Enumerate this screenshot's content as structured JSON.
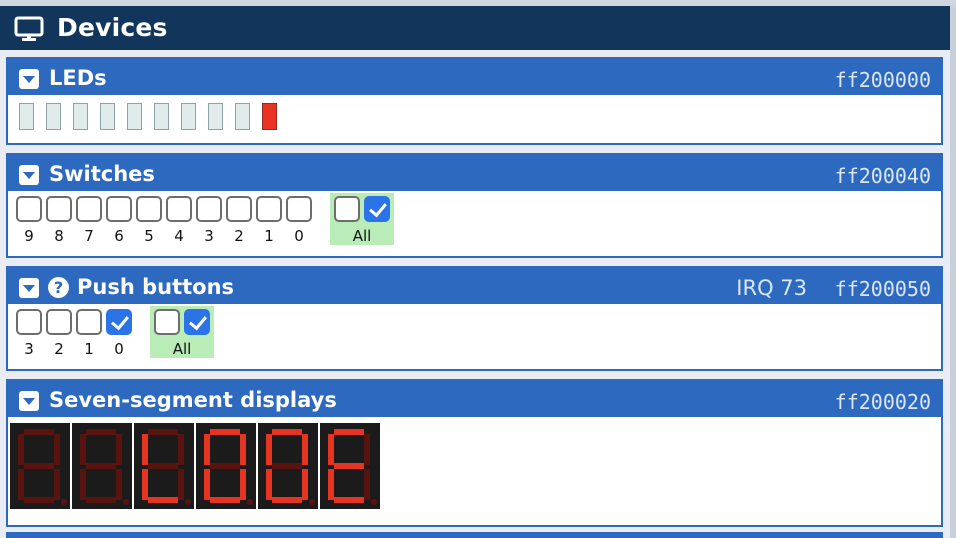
{
  "header": {
    "title": "Devices",
    "icon": "monitor-icon"
  },
  "leds": {
    "title": "LEDs",
    "address": "ff200000",
    "states": [
      false,
      false,
      false,
      false,
      false,
      false,
      false,
      false,
      false,
      true
    ],
    "on_color": "#ea3323",
    "off_color": "#e0eceb"
  },
  "switches": {
    "title": "Switches",
    "address": "ff200040",
    "bits": [
      {
        "label": "9",
        "checked": false
      },
      {
        "label": "8",
        "checked": false
      },
      {
        "label": "7",
        "checked": false
      },
      {
        "label": "6",
        "checked": false
      },
      {
        "label": "5",
        "checked": false
      },
      {
        "label": "4",
        "checked": false
      },
      {
        "label": "3",
        "checked": false
      },
      {
        "label": "2",
        "checked": false
      },
      {
        "label": "1",
        "checked": false
      },
      {
        "label": "0",
        "checked": false
      }
    ],
    "all_label": "All",
    "all_boxes": [
      false,
      true
    ]
  },
  "push_buttons": {
    "title": "Push buttons",
    "irq": "IRQ 73",
    "address": "ff200050",
    "bits": [
      {
        "label": "3",
        "checked": false
      },
      {
        "label": "2",
        "checked": false
      },
      {
        "label": "1",
        "checked": false
      },
      {
        "label": "0",
        "checked": true
      }
    ],
    "all_label": "All",
    "all_boxes": [
      false,
      true
    ]
  },
  "seven_segment": {
    "title": "Seven-segment displays",
    "address": "ff200020",
    "digits": [
      {
        "segments": []
      },
      {
        "segments": []
      },
      {
        "segments": [
          "f",
          "e",
          "d"
        ]
      },
      {
        "segments": [
          "a",
          "b",
          "c",
          "d",
          "e",
          "f"
        ]
      },
      {
        "segments": [
          "a",
          "b",
          "c",
          "d",
          "e",
          "f"
        ]
      },
      {
        "segments": [
          "a",
          "f",
          "g",
          "e",
          "d"
        ]
      }
    ],
    "segment_on_color": "#e53421",
    "segment_off_color": "#5a1410"
  }
}
